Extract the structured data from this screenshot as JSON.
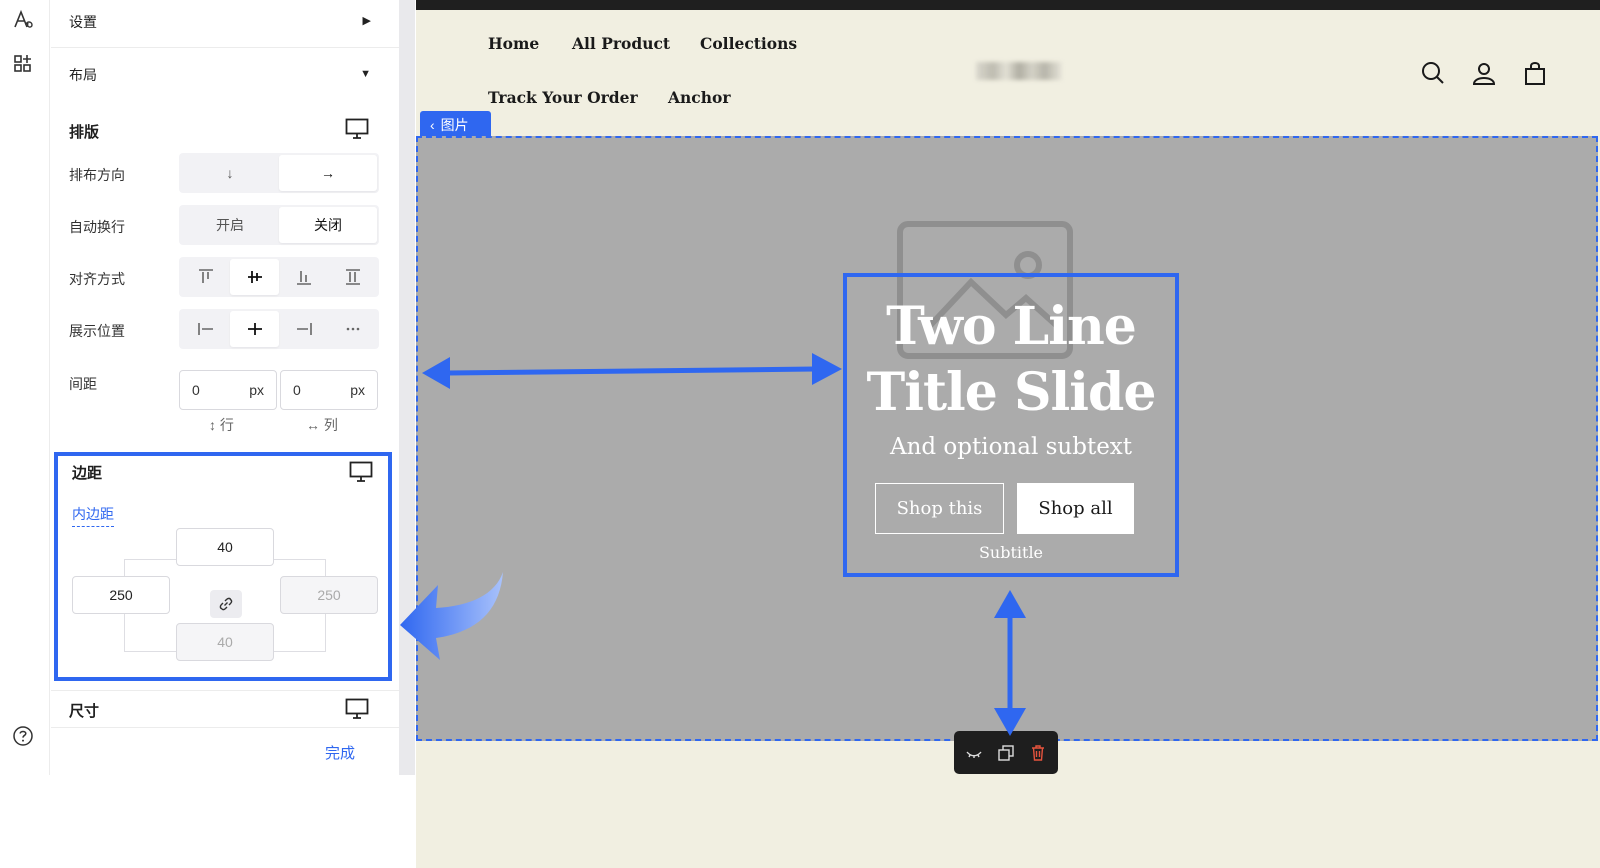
{
  "rail": {
    "icons": [
      "text-style-icon",
      "add-section-icon",
      "help-icon"
    ]
  },
  "panel": {
    "settings_label": "设置",
    "layout_label": "布局",
    "typesetting": {
      "title": "排版",
      "direction_label": "排布方向",
      "direction_options": [
        "↓",
        "→"
      ],
      "direction_selected": "→",
      "wrap_label": "自动换行",
      "wrap_on": "开启",
      "wrap_off": "关闭",
      "wrap_selected": "关闭",
      "align_label": "对齐方式",
      "position_label": "展示位置",
      "gap_label": "间距",
      "gap_row_value": "0",
      "gap_col_value": "0",
      "unit": "px",
      "row_label": "行",
      "col_label": "列"
    },
    "margin": {
      "title": "边距",
      "tab_label": "内边距",
      "top": "40",
      "left": "250",
      "right": "250",
      "bottom": "40"
    },
    "size_title": "尺寸",
    "done_label": "完成"
  },
  "store": {
    "nav": [
      "Home",
      "All Product",
      "Collections",
      "Track Your Order",
      "Anchor"
    ],
    "image_tab_label": "图片",
    "slide": {
      "title_line1": "Two Line",
      "title_line2": "Title Slide",
      "subtext": "And optional subtext",
      "button_primary": "Shop this",
      "button_secondary": "Shop all",
      "caption": "Subtitle"
    }
  },
  "colors": {
    "accent": "#2f67f0",
    "preview_bg": "#f1efe1",
    "banner_bg": "#ababab",
    "delete_red": "#e5533d"
  }
}
